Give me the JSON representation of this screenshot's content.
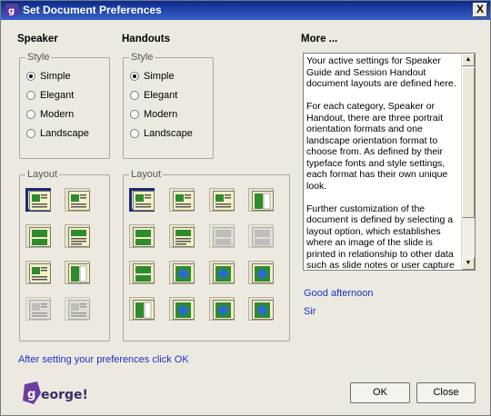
{
  "window": {
    "title": "Set Document Preferences",
    "close_label": "X"
  },
  "speaker": {
    "heading": "Speaker",
    "style_legend": "Style",
    "styles": [
      "Simple",
      "Elegant",
      "Modern",
      "Landscape"
    ],
    "selected_style": "Simple",
    "layout_legend": "Layout"
  },
  "handouts": {
    "heading": "Handouts",
    "style_legend": "Style",
    "styles": [
      "Simple",
      "Elegant",
      "Modern",
      "Landscape"
    ],
    "selected_style": "Simple",
    "layout_legend": "Layout"
  },
  "more": {
    "heading": "More ...",
    "text": "Your active settings for Speaker Guide and Session Handout document layouts are defined here.\n\nFor each category, Speaker or Handout, there are three portrait orientation formats and one landscape orientation format to choose from. As defined by their typeface fonts and style settings, each format has their own unique look.\n\nFurther customization of the document is defined by selecting a layout option, which establishes where an image of the slide is printed in relationship to other data such as slide notes or user capture space on the page.  Hover your cursor over any specific layout icon and a description of that icon is",
    "greeting": "Good afternoon",
    "name": "Sir"
  },
  "footer": {
    "hint": "After setting your preferences click OK",
    "ok_label": "OK",
    "close_label": "Close",
    "logo_text": "eorge!"
  },
  "colors": {
    "title_bar": "#0a2a8c",
    "link": "#1a30c8",
    "selected_border": "#1a2a78",
    "icon_green": "#2e8b2e",
    "icon_blue": "#2a6ad0"
  }
}
